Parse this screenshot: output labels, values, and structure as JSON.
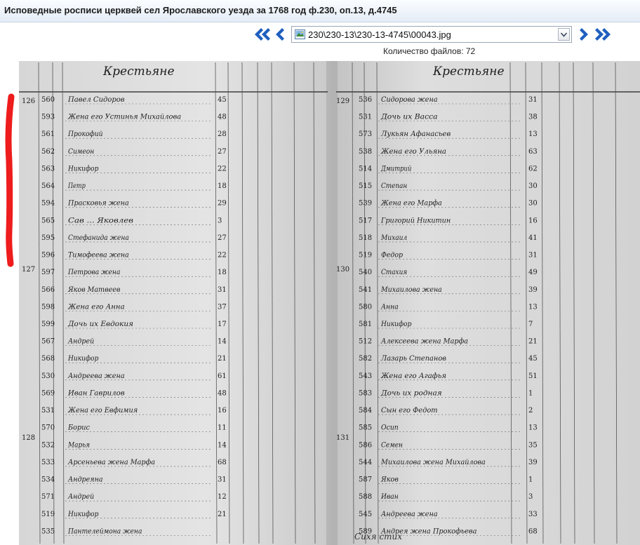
{
  "window": {
    "title": "Исповедные росписи церквей сел Ярославского уезда за 1768 год ф.230, оп.13, д.4745"
  },
  "navigation": {
    "first_icon": "double-chevron-left-icon",
    "prev_icon": "chevron-left-icon",
    "next_icon": "chevron-right-icon",
    "last_icon": "double-chevron-right-icon",
    "accent_color": "#1f5fbf"
  },
  "file_selector": {
    "selected": "230\\230-13\\230-13-4745\\00043.jpg",
    "icon": "image-file-icon"
  },
  "file_count": {
    "text": "Количество файлов: 72"
  },
  "document": {
    "description_icon": "scanned-manuscript-page",
    "left_header": "Крестьяне",
    "right_header": "Крестьяне",
    "left_household_numbers": [
      "126",
      "127",
      "128"
    ],
    "right_household_numbers": [
      "129",
      "130",
      "131"
    ],
    "left_row_numbers": [
      "560",
      "593",
      "561",
      "562",
      "563",
      "564",
      "594",
      "565",
      "595",
      "596",
      "597",
      "566",
      "598",
      "599",
      "567",
      "568",
      "530",
      "569",
      "531",
      "570",
      "532",
      "533",
      "534",
      "571",
      "519",
      "535"
    ],
    "right_row_numbers": [
      "536",
      "531",
      "573",
      "538",
      "514",
      "515",
      "539",
      "517",
      "518",
      "519",
      "540",
      "541",
      "580",
      "581",
      "512",
      "582",
      "543",
      "583",
      "584",
      "585",
      "586",
      "544",
      "587",
      "588",
      "545",
      "589"
    ],
    "left_ages": [
      "45",
      "48",
      "28",
      "27",
      "22",
      "18",
      "29",
      "3",
      "27",
      "22",
      "18",
      "31",
      "37",
      "17",
      "14",
      "21",
      "61",
      "48",
      "16",
      "11",
      "14",
      "68",
      "31",
      "12",
      "21"
    ],
    "right_ages": [
      "31",
      "38",
      "13",
      "63",
      "62",
      "30",
      "30",
      "16",
      "41",
      "31",
      "49",
      "39",
      "13",
      "7",
      "21",
      "45",
      "51",
      "1",
      "2",
      "13",
      "35",
      "39",
      "1",
      "3",
      "33",
      "68"
    ],
    "left_names": [
      "Павел Сидоров",
      "Жена его Устинья Михайлова",
      "Прокофий",
      "Симеон",
      "Никифор",
      "Петр",
      "Прасковья жена",
      "Сав ... Яковлев",
      "Стефанида жена",
      "Тимофеева жена",
      "Петрова жена",
      "Яков Матвеев",
      "Жена его Анна",
      "Дочь их Евдокия",
      "Андрей",
      "Никифор",
      "Андреева жена",
      "Иван Гаврилов",
      "Жена его Евфимия",
      "Борис",
      "Марья",
      "Арсеньева жена Марфа",
      "Андреяна",
      "Андрей",
      "Никифор",
      "Пантелеймона жена"
    ],
    "right_names": [
      "Сидорова жена",
      "Дочь их Васса",
      "Лукьян Афанасьев",
      "Жена его Ульяна",
      "Дмитрий",
      "Степан",
      "Жена его Марфа",
      "Григорий Никитин",
      "Михаил",
      "Федор",
      "Стахия",
      "Михаилова жена",
      "Анна",
      "Никифор",
      "Алексеева жена Марфа",
      "Лазарь Степанов",
      "Жена его Агафья",
      "Дочь их родная",
      "Сын его Федот",
      "Осип",
      "Семен",
      "Михаилова жена Михайлова",
      "Яков",
      "Иван",
      "Андреева жена",
      "Андрея жена Прокофьева"
    ],
    "bottom_text": "Сихя стих"
  },
  "annotation": {
    "marker_color": "#ee1c1c"
  }
}
